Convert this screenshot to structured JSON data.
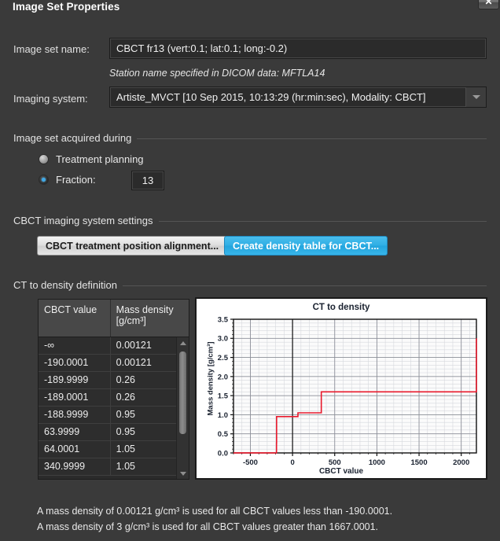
{
  "dialog": {
    "title": "Image Set Properties",
    "close_label": "✕"
  },
  "form": {
    "image_set_name_label": "Image set name:",
    "image_set_name_value": "CBCT fr13 (vert:0.1; lat:0.1; long:-0.2)",
    "station_name_note": "Station name specified in DICOM data:  MFTLA14",
    "imaging_system_label": "Imaging system:",
    "imaging_system_value": "Artiste_MVCT [10 Sep 2015, 10:13:29 (hr:min:sec), Modality: CBCT]"
  },
  "acquired_group": {
    "title": "Image set acquired during",
    "options": [
      {
        "label": "Treatment planning",
        "checked": false
      },
      {
        "label": "Fraction:",
        "checked": true
      }
    ],
    "fraction_value": "13"
  },
  "cbct_group": {
    "title": "CBCT imaging system settings",
    "alignment_button": "CBCT treatment position alignment...",
    "create_density_button": "Create density table for CBCT...",
    "accent_color": "#2eaee4"
  },
  "ct_density_group": {
    "title": "CT to density definition",
    "table": {
      "columns": [
        "CBCT value",
        "Mass density [g/cm³]"
      ],
      "rows": [
        [
          "-∞",
          "0.00121"
        ],
        [
          "-190.0001",
          "0.00121"
        ],
        [
          "-189.9999",
          "0.26"
        ],
        [
          "-189.0001",
          "0.26"
        ],
        [
          "-188.9999",
          "0.95"
        ],
        [
          "63.9999",
          "0.95"
        ],
        [
          "64.0001",
          "1.05"
        ],
        [
          "340.9999",
          "1.05"
        ]
      ]
    }
  },
  "chart_data": {
    "type": "line",
    "title": "CT to density",
    "xlabel": "CBCT value",
    "ylabel": "Mass density [g/cm³]",
    "xlim": [
      -700,
      2180
    ],
    "ylim": [
      0.0,
      3.5
    ],
    "xticks": [
      -500,
      0,
      500,
      1000,
      1500,
      2000
    ],
    "xtick_labels": [
      "-500",
      "0",
      "500",
      "1000",
      "1500",
      "2000"
    ],
    "yticks": [
      0.0,
      0.5,
      1.0,
      1.5,
      2.0,
      2.5,
      3.0,
      3.5
    ],
    "ytick_labels": [
      "0.0",
      "0.5",
      "1.0",
      "1.5",
      "2.0",
      "2.5",
      "3.0",
      "3.5"
    ],
    "grid": true,
    "legend": null,
    "series": [
      {
        "name": "CT to density",
        "color": "#e8192c",
        "step": true,
        "x": [
          -700,
          -190.0001,
          -189.9999,
          -189.0001,
          -188.9999,
          63.9999,
          64.0001,
          340.9999,
          341.0001,
          1667.0001,
          2180
        ],
        "y": [
          0.00121,
          0.00121,
          0.26,
          0.26,
          0.95,
          0.95,
          1.05,
          1.05,
          1.6,
          1.6,
          3.0
        ]
      }
    ]
  },
  "footer": {
    "note_1": "A mass density of 0.00121 g/cm³ is used for all CBCT values less than -190.0001.",
    "note_2": "A mass density of 3 g/cm³ is used for all CBCT values greater than 1667.0001."
  }
}
